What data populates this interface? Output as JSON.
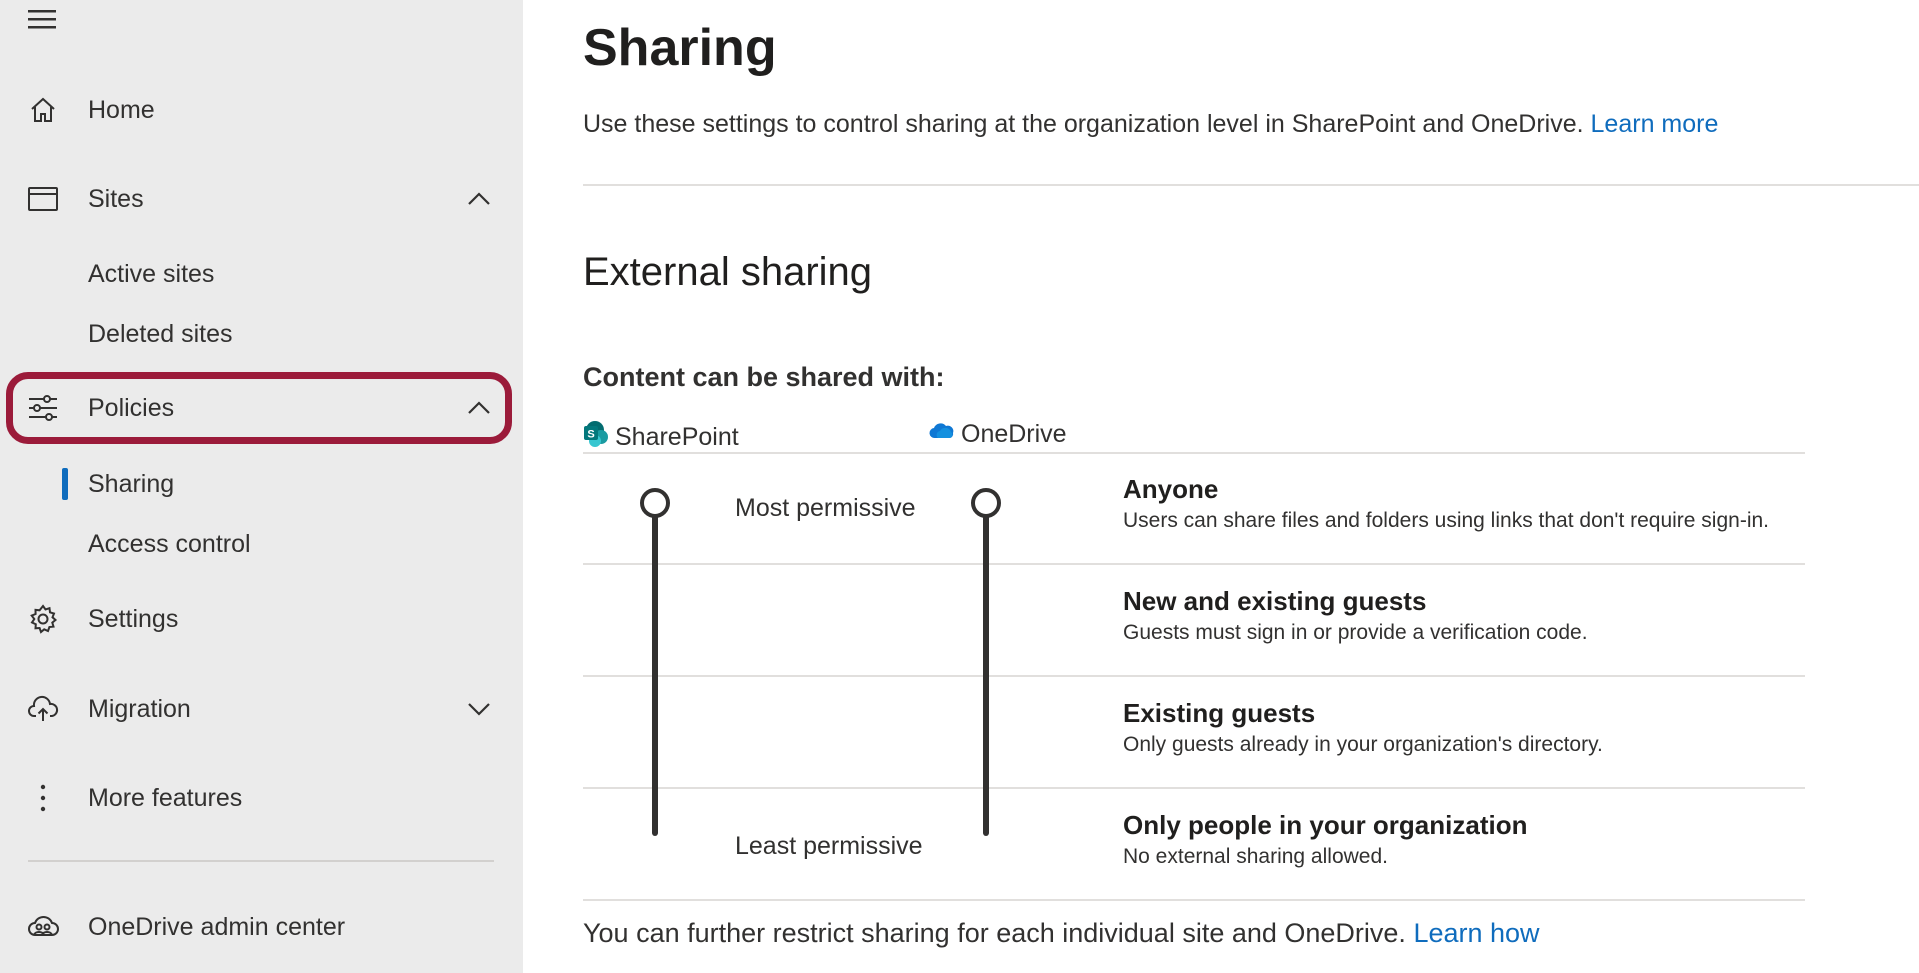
{
  "sidebar": {
    "items": [
      {
        "label": "Home",
        "icon": "home-icon"
      },
      {
        "label": "Sites",
        "icon": "browser-window-icon",
        "expanded": true
      },
      {
        "label": "Active sites"
      },
      {
        "label": "Deleted sites"
      },
      {
        "label": "Policies",
        "icon": "sliders-icon",
        "expanded": true,
        "highlighted": true
      },
      {
        "label": "Sharing",
        "selected": true
      },
      {
        "label": "Access control"
      },
      {
        "label": "Settings",
        "icon": "gear-icon"
      },
      {
        "label": "Migration",
        "icon": "cloud-upload-icon",
        "expanded": false
      },
      {
        "label": "More features",
        "icon": "more-vertical-icon"
      },
      {
        "label": "OneDrive admin center",
        "icon": "cloud-people-icon"
      }
    ],
    "highlight_color": "#9b1b3a",
    "selected_indicator_color": "#0f6cbd"
  },
  "main": {
    "title": "Sharing",
    "description": "Use these settings to control sharing at the organization level in SharePoint and OneDrive.",
    "description_link": "Learn more",
    "section_title": "External sharing",
    "content_label": "Content can be shared with:",
    "apps": [
      {
        "name": "SharePoint",
        "icon": "sharepoint-logo",
        "color": "#038387"
      },
      {
        "name": "OneDrive",
        "icon": "onedrive-logo",
        "color": "#0f78d4"
      }
    ],
    "most_permissive_label": "Most permissive",
    "least_permissive_label": "Least permissive",
    "sharepoint_level": "Anyone",
    "onedrive_level": "Anyone",
    "options": [
      {
        "title": "Anyone",
        "desc": "Users can share files and folders using links that don't require sign-in."
      },
      {
        "title": "New and existing guests",
        "desc": "Guests must sign in or provide a verification code."
      },
      {
        "title": "Existing guests",
        "desc": "Only guests already in your organization's directory."
      },
      {
        "title": "Only people in your organization",
        "desc": "No external sharing allowed."
      }
    ],
    "footer_note": "You can further restrict sharing for each individual site and OneDrive.",
    "footer_link": "Learn how",
    "link_color": "#0f6cbd"
  }
}
